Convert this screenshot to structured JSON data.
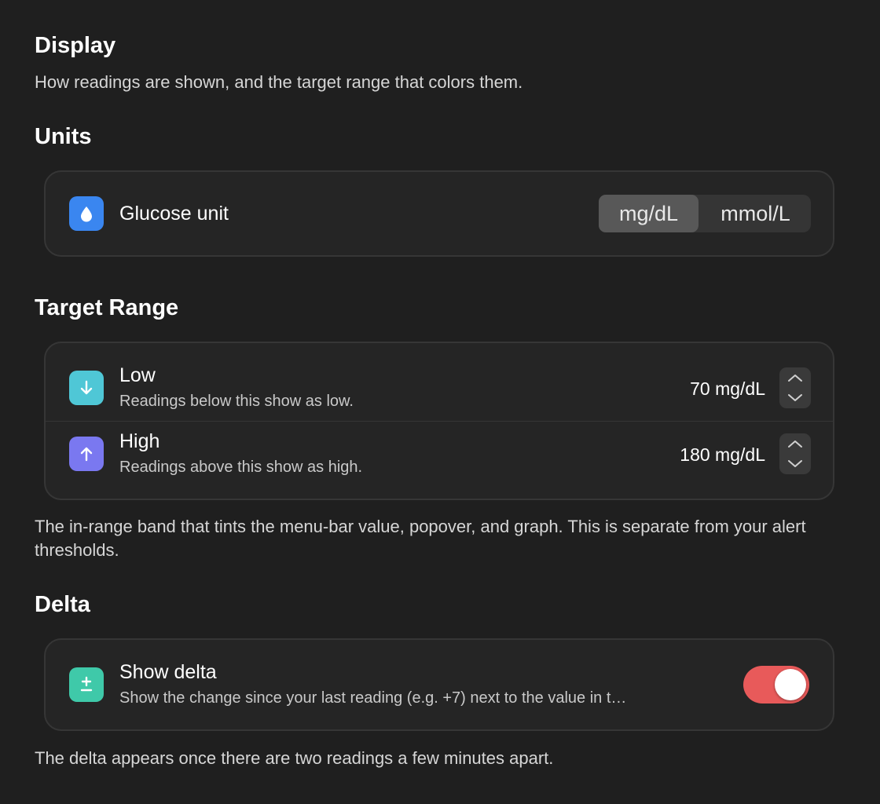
{
  "header": {
    "title": "Display",
    "description": "How readings are shown, and the target range that colors them."
  },
  "units": {
    "section_title": "Units",
    "glucose_unit": {
      "label": "Glucose unit",
      "icon": "drop-icon",
      "icon_color": "#3a86f0",
      "options": [
        "mg/dL",
        "mmol/L"
      ],
      "selected": "mg/dL"
    }
  },
  "target_range": {
    "section_title": "Target Range",
    "low": {
      "title": "Low",
      "subtitle": "Readings below this show as low.",
      "value": "70 mg/dL",
      "icon": "arrow-down-icon",
      "icon_color": "#4fc7d6"
    },
    "high": {
      "title": "High",
      "subtitle": "Readings above this show as high.",
      "value": "180 mg/dL",
      "icon": "arrow-up-icon",
      "icon_color": "#7a78f0"
    },
    "footnote": "The in-range band that tints the menu-bar value, popover, and graph. This is separate from your alert thresholds."
  },
  "delta": {
    "section_title": "Delta",
    "show_delta": {
      "title": "Show delta",
      "subtitle": "Show the change since your last reading (e.g. +7) next to the value in t…",
      "icon": "plus-minus-icon",
      "icon_color": "#3fc9a9",
      "enabled": true,
      "toggle_color": "#e85a5a"
    },
    "footnote": "The delta appears once there are two readings a few minutes apart."
  }
}
